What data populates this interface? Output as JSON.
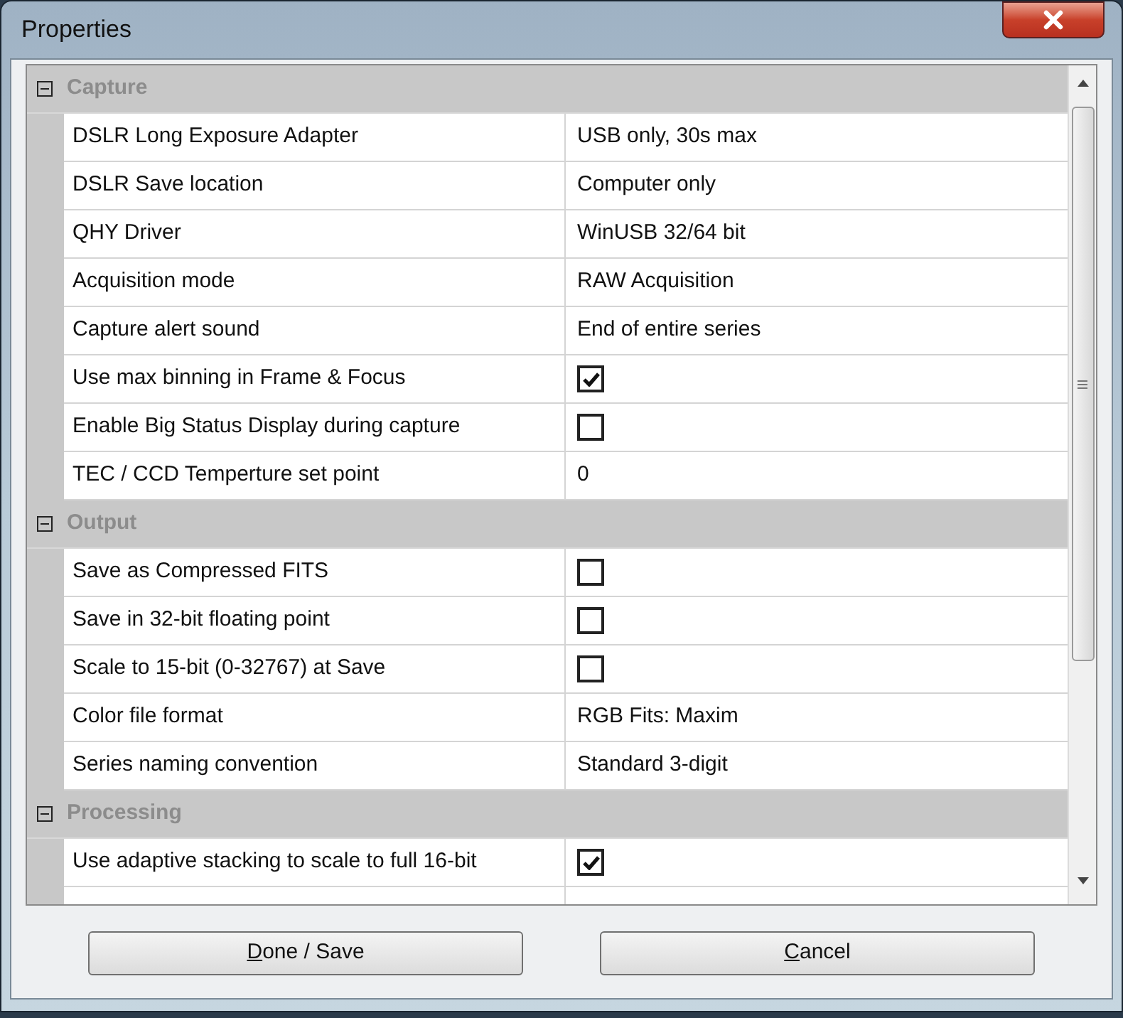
{
  "window": {
    "title": "Properties"
  },
  "categories": [
    {
      "name": "Capture",
      "expanded": true,
      "rows": [
        {
          "name": "DSLR Long Exposure Adapter",
          "kind": "text",
          "value": "USB only, 30s max"
        },
        {
          "name": "DSLR Save location",
          "kind": "text",
          "value": "Computer only"
        },
        {
          "name": "QHY Driver",
          "kind": "text",
          "value": "WinUSB 32/64 bit"
        },
        {
          "name": "Acquisition mode",
          "kind": "text",
          "value": "RAW Acquisition"
        },
        {
          "name": "Capture alert sound",
          "kind": "text",
          "value": "End of entire series"
        },
        {
          "name": "Use max binning in Frame & Focus",
          "kind": "checkbox",
          "checked": true
        },
        {
          "name": "Enable Big Status Display during capture",
          "kind": "checkbox",
          "checked": false
        },
        {
          "name": "TEC / CCD Temperture set point",
          "kind": "text",
          "value": "0"
        }
      ]
    },
    {
      "name": "Output",
      "expanded": true,
      "rows": [
        {
          "name": "Save as Compressed FITS",
          "kind": "checkbox",
          "checked": false
        },
        {
          "name": "Save in 32-bit floating point",
          "kind": "checkbox",
          "checked": false
        },
        {
          "name": "Scale to 15-bit (0-32767) at Save",
          "kind": "checkbox",
          "checked": false
        },
        {
          "name": "Color file format",
          "kind": "text",
          "value": "RGB Fits: Maxim"
        },
        {
          "name": "Series naming convention",
          "kind": "text",
          "value": "Standard 3-digit"
        }
      ]
    },
    {
      "name": "Processing",
      "expanded": true,
      "rows": [
        {
          "name": "Use adaptive stacking to scale to full 16-bit",
          "kind": "checkbox",
          "checked": true
        }
      ]
    }
  ],
  "buttons": [
    {
      "label": "Done / Save"
    },
    {
      "label": "Cancel"
    }
  ]
}
